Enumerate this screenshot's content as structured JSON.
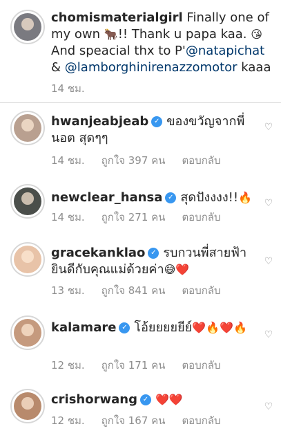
{
  "caption": {
    "username": "chomismaterialgirl",
    "text_1": "Finally one of my own",
    "emoji_bull": "🐂",
    "text_2": "!! Thank u papa kaa.",
    "emoji_kiss": "😘",
    "text_3": "And speacial thx to P'",
    "mention_1": "@natapichat",
    "text_4": "&",
    "mention_2": "@lamborghinirenazzomotor",
    "text_5": "kaaa",
    "time": "14 ชม."
  },
  "comments": [
    {
      "username": "hwanjeabjeab",
      "verified": "✓",
      "text": "ของขวัญจากพี่นอต สุดๆๆ",
      "emoji": "",
      "time": "14 ชม.",
      "likes": "ถูกใจ 397 คน",
      "reply": "ตอบกลับ",
      "avatar_color": "#b9a090"
    },
    {
      "username": "newclear_hansa",
      "verified": "✓",
      "text": "สุดปังงงง!!",
      "emoji": "🔥",
      "time": "14 ชม.",
      "likes": "ถูกใจ 271 คน",
      "reply": "ตอบกลับ",
      "avatar_color": "#4a4e4a"
    },
    {
      "username": "gracekanklao",
      "verified": "✓",
      "text": "รบกวนพี่สายฟ้ายินดีกับคุณแม่ด้วยค่า",
      "emoji": "😅❤️",
      "time": "13 ชม.",
      "likes": "ถูกใจ 841 คน",
      "reply": "ตอบกลับ",
      "avatar_color": "#e8c3a8"
    },
    {
      "username": "kalamare",
      "verified": "✓",
      "text": "โอ้ยยยยยีย์",
      "emoji": "❤️🔥❤️🔥",
      "time": "12 ชม.",
      "likes": "ถูกใจ 171 คน",
      "reply": "ตอบกลับ",
      "avatar_color": "#c59a7e"
    },
    {
      "username": "crishorwang",
      "verified": "✓",
      "text": "",
      "emoji": "❤️❤️",
      "time": "12 ชม.",
      "likes": "ถูกใจ 167 คน",
      "reply": "ตอบกลับ",
      "avatar_color": "#b88a6c"
    }
  ],
  "icons": {
    "like": "heart-outline-icon",
    "verified": "verified-badge-icon"
  }
}
